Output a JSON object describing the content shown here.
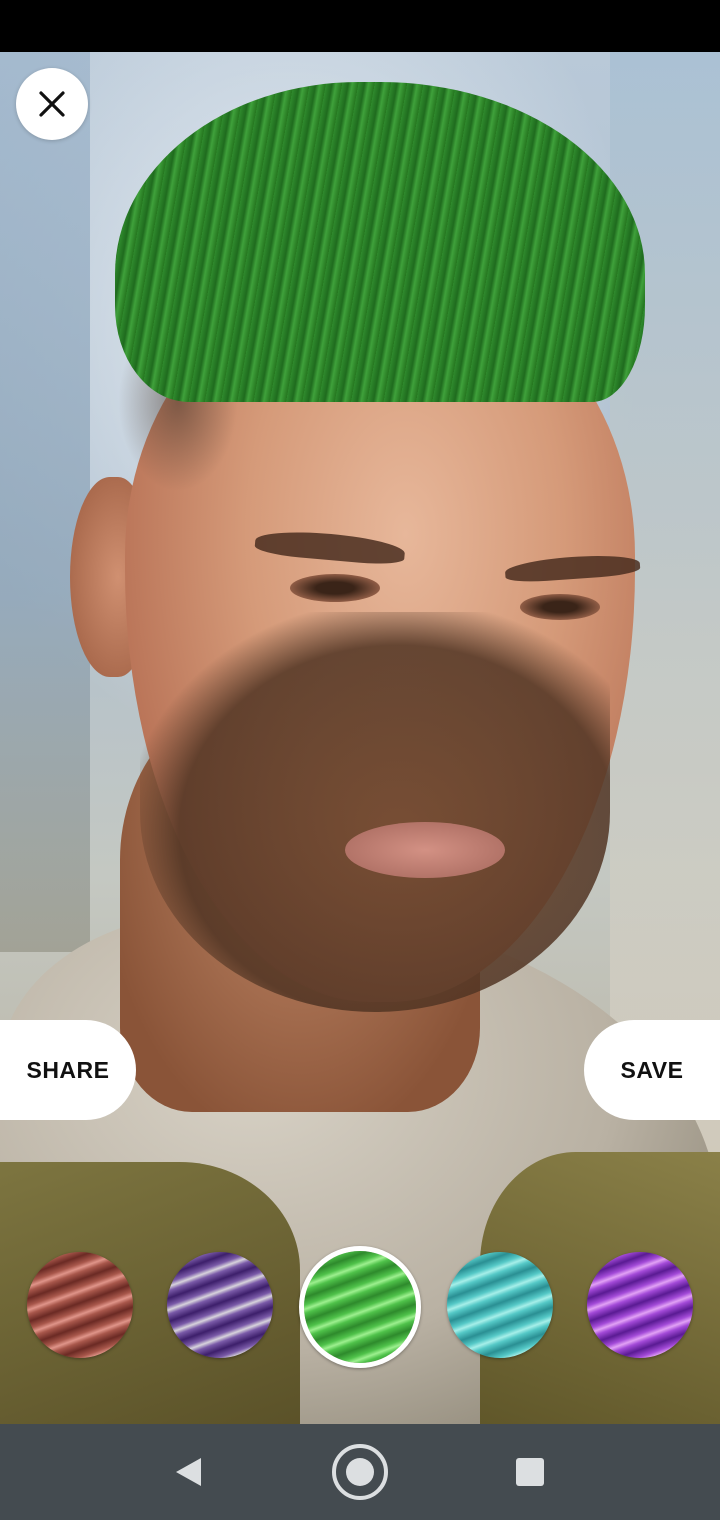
{
  "actions": {
    "share_label": "SHARE",
    "save_label": "SAVE"
  },
  "swatches": [
    {
      "name": "copper-red",
      "colors": [
        "#6b2a24",
        "#a8574b",
        "#e0958a"
      ],
      "selected": false
    },
    {
      "name": "purple-silver",
      "colors": [
        "#3d1f6b",
        "#7a5aa8",
        "#d8d4dc"
      ],
      "selected": false
    },
    {
      "name": "green",
      "colors": [
        "#2e8a2c",
        "#4fc24a",
        "#9df08f"
      ],
      "selected": true
    },
    {
      "name": "teal",
      "colors": [
        "#2a8f93",
        "#55c9c7",
        "#a6efe9"
      ],
      "selected": false
    },
    {
      "name": "violet",
      "colors": [
        "#5a1b93",
        "#a34ad8",
        "#e2a2f5"
      ],
      "selected": false
    }
  ],
  "icons": {
    "close": "close-icon",
    "back": "back-triangle-icon",
    "home": "home-circle-icon",
    "recent": "recent-square-icon"
  },
  "colors": {
    "nav_bar": "#444b50",
    "button_bg": "#ffffff",
    "button_text": "#111111"
  }
}
